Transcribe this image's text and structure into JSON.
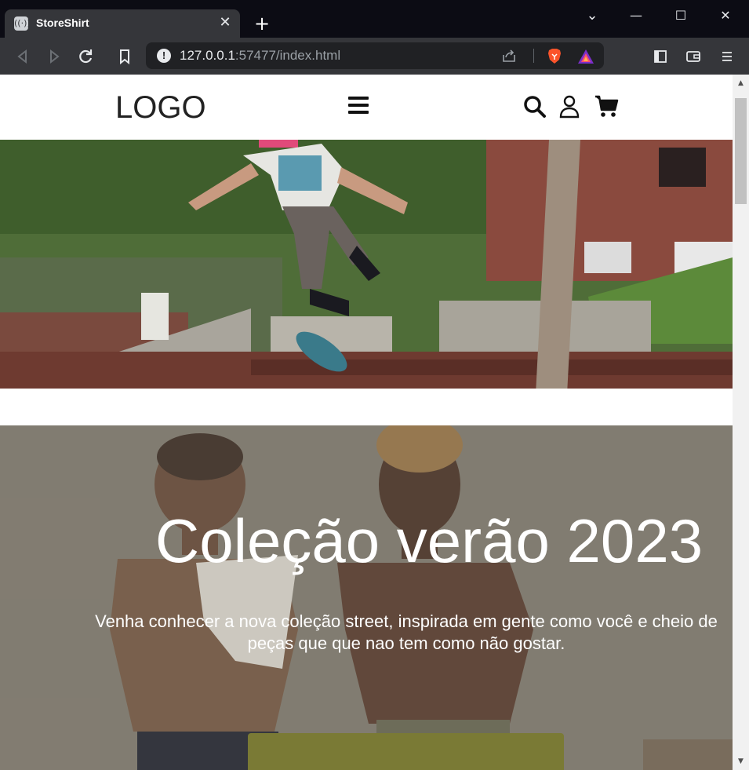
{
  "browser": {
    "tab_title": "StoreShirt",
    "tab_close": "✕",
    "new_tab": "+",
    "url_host": "127.0.0.1",
    "url_rest": ":57477/index.html",
    "controls": {
      "dropdown": "⌄",
      "minimize": "—",
      "maximize": "☐",
      "close": "✕"
    }
  },
  "site": {
    "logo": "LOGO",
    "hero_title": "Coleção verão 2023",
    "hero_text": "Venha conhecer a nova coleção street, inspirada em gente como você e cheio de peças que que nao tem como não gostar."
  },
  "icons": [
    "back-icon",
    "forward-icon",
    "reload-icon",
    "bookmark-icon",
    "share-icon",
    "brave-icon",
    "rewards-icon",
    "sidebar-icon",
    "wallet-icon",
    "menu-icon",
    "hamburger-icon",
    "search-icon",
    "user-icon",
    "cart-icon"
  ],
  "colors": {
    "button": "#7a7a35",
    "header_bg": "#ffffff",
    "chrome_dark": "#0c0c14",
    "toolbar": "#35363a"
  }
}
